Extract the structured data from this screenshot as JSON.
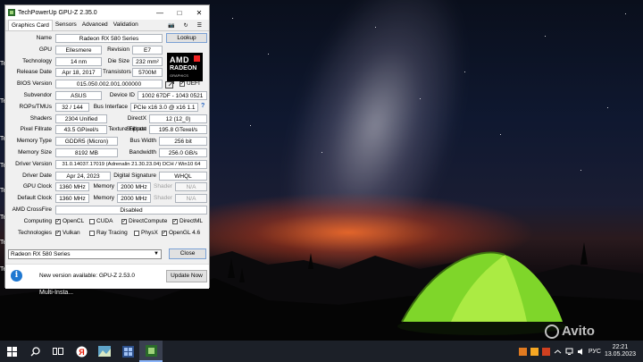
{
  "window": {
    "title": "TechPowerUp GPU-Z 2.35.0",
    "tabs": [
      "Graphics Card",
      "Sensors",
      "Advanced",
      "Validation"
    ],
    "fields": {
      "name_label": "Name",
      "name": "Radeon RX 580 Series",
      "lookup": "Lookup",
      "gpu_label": "GPU",
      "gpu": "Ellesmere",
      "revision_label": "Revision",
      "revision": "E7",
      "technology_label": "Technology",
      "technology": "14 nm",
      "die_size_label": "Die Size",
      "die_size": "232 mm²",
      "release_date_label": "Release Date",
      "release_date": "Apr 18, 2017",
      "transistors_label": "Transistors",
      "transistors": "5700M",
      "bios_label": "BIOS Version",
      "bios": "015.050.002.001.000000",
      "uefi": "UEFI",
      "subvendor_label": "Subvendor",
      "subvendor": "ASUS",
      "device_id_label": "Device ID",
      "device_id": "1002 67DF - 1043 0521",
      "rops_label": "ROPs/TMUs",
      "rops": "32 / 144",
      "bus_label": "Bus Interface",
      "bus": "PCIe x16 3.0 @ x16 1.1",
      "help": "?",
      "shaders_label": "Shaders",
      "shaders": "2304 Unified",
      "dx_label": "DirectX Support",
      "dx": "12 (12_0)",
      "pixel_label": "Pixel Fillrate",
      "pixel": "43.5 GPixel/s",
      "texture_label": "Texture Fillrate",
      "texture": "195.8 GTexel/s",
      "memtype_label": "Memory Type",
      "memtype": "GDDR5 (Micron)",
      "buswidth_label": "Bus Width",
      "buswidth": "256 bit",
      "memsize_label": "Memory Size",
      "memsize": "8192 MB",
      "bandwidth_label": "Bandwidth",
      "bandwidth": "256.0 GB/s",
      "driver_label": "Driver Version",
      "driver": "31.0.14037.17019 (Adrenalin 21.30.23.04) DCH / Win10 64",
      "driver_date_label": "Driver Date",
      "driver_date": "Apr 24, 2023",
      "signature_label": "Digital Signature",
      "signature": "WHQL",
      "gpu_clock_label": "GPU Clock",
      "gpu_clock": "1360 MHz",
      "mem_label": "Memory",
      "gpu_mem_clock": "2000 MHz",
      "shader_label": "Shader",
      "na": "N/A",
      "default_clock_label": "Default Clock",
      "default_clock": "1360 MHz",
      "default_mem_clock": "2000 MHz",
      "crossfire_label": "AMD CrossFire",
      "crossfire": "Disabled",
      "computing_label": "Computing",
      "technologies_label": "Technologies"
    },
    "computing": [
      {
        "label": "OpenCL",
        "checked": true
      },
      {
        "label": "CUDA",
        "checked": false
      },
      {
        "label": "DirectCompute",
        "checked": true
      },
      {
        "label": "DirectML",
        "checked": true
      }
    ],
    "technologies": [
      {
        "label": "Vulkan",
        "checked": true
      },
      {
        "label": "Ray Tracing",
        "checked": false
      },
      {
        "label": "PhysX",
        "checked": false
      },
      {
        "label": "OpenGL 4.6",
        "checked": true
      }
    ],
    "amd_logo": {
      "brand": "AMD",
      "product": "RADEON",
      "sub": "GRAPHICS"
    },
    "gpu_select": "Radeon RX 580 Series",
    "close": "Close",
    "notice": {
      "text": "New version available: GPU-Z 2.53.0",
      "button": "Update Now",
      "icon": "i"
    }
  },
  "desktop": {
    "multi_label": "Multi-Insta...",
    "left_labels": [
      "Te",
      "Te",
      "Te",
      "Te",
      "Te",
      "Te",
      "Te",
      "Te"
    ]
  },
  "taskbar": {
    "lang": "РУС",
    "time": "22:21",
    "date": "13.05.2023"
  },
  "watermark": "Avito",
  "colors": {
    "accent": "#1f78d1",
    "amd_red": "#e22222",
    "taskbar": "#1c2028"
  }
}
